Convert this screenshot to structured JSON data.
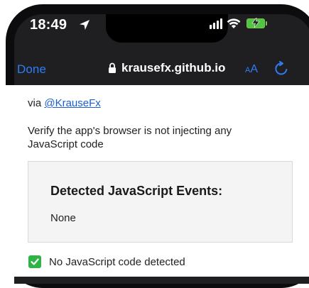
{
  "status_bar": {
    "time": "18:49",
    "icons": [
      "location-arrow-icon",
      "cellular-signal-icon",
      "wifi-icon",
      "battery-charging-icon"
    ]
  },
  "toolbar": {
    "done_label": "Done",
    "url": "krausefx.github.io",
    "text_size_label_small": "A",
    "text_size_label_big": "A"
  },
  "page": {
    "via_prefix": "via ",
    "via_link": "@KrauseFx",
    "verify_text": "Verify the app's browser is not injecting any JavaScript code",
    "events_box": {
      "title": "Detected JavaScript Events:",
      "value": "None"
    },
    "result_text": "No JavaScript code detected"
  },
  "colors": {
    "accent_blue": "#2f7cf6",
    "link_blue": "#1a5fd1",
    "check_green": "#2fb344",
    "battery_green": "#52c443"
  }
}
